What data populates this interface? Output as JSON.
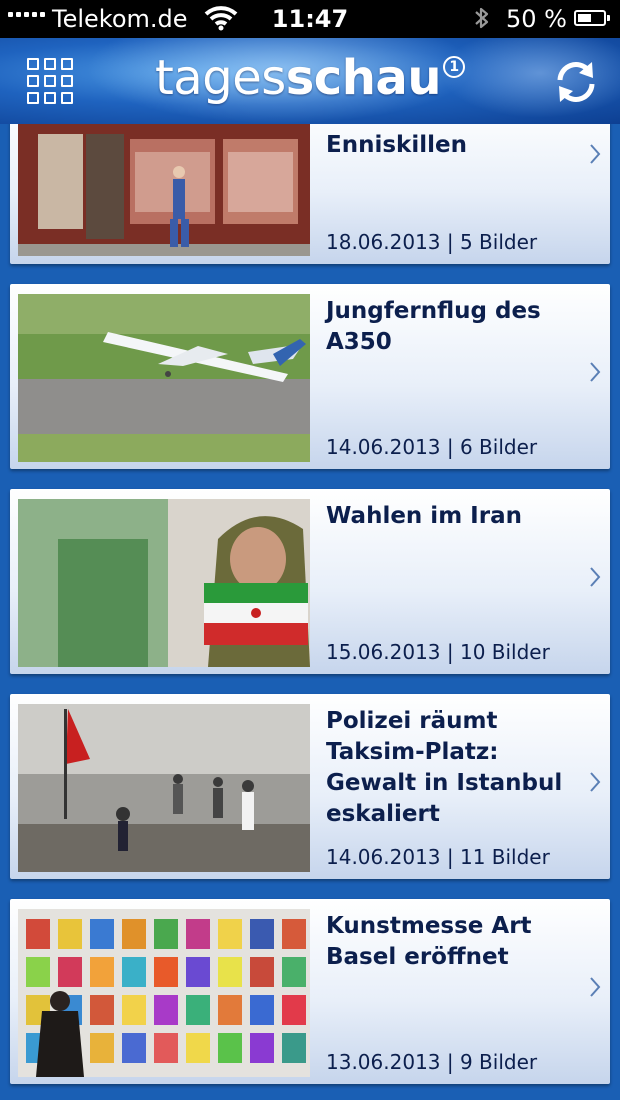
{
  "status_bar": {
    "carrier": "Telekom.de",
    "time": "11:47",
    "battery": "50 %",
    "battery_level": 0.5,
    "icons": [
      "signal-icon",
      "wifi-icon",
      "bluetooth-icon",
      "battery-icon"
    ]
  },
  "nav": {
    "logo_part1": "tages",
    "logo_part2": "schau",
    "logo_mark": "1",
    "icons": [
      "grid-menu-icon",
      "refresh-icon"
    ]
  },
  "gallery": [
    {
      "title": "Wurst in Enniskillen",
      "meta": "18.06.2013 | 5 Bilder"
    },
    {
      "title": "Jungfernflug des A350",
      "meta": "14.06.2013 | 6 Bilder"
    },
    {
      "title": "Wahlen im Iran",
      "meta": "15.06.2013 | 10 Bilder"
    },
    {
      "title": "Polizei räumt Taksim-Platz: Gewalt in Istanbul eskaliert",
      "meta": "14.06.2013 | 11 Bilder"
    },
    {
      "title": "Kunstmesse Art Basel eröffnet",
      "meta": "13.06.2013 | 9 Bilder"
    }
  ],
  "colors": {
    "background": "#1a5fb4",
    "title_text": "#0c1f4d",
    "chevron": "#5a7fb5"
  }
}
